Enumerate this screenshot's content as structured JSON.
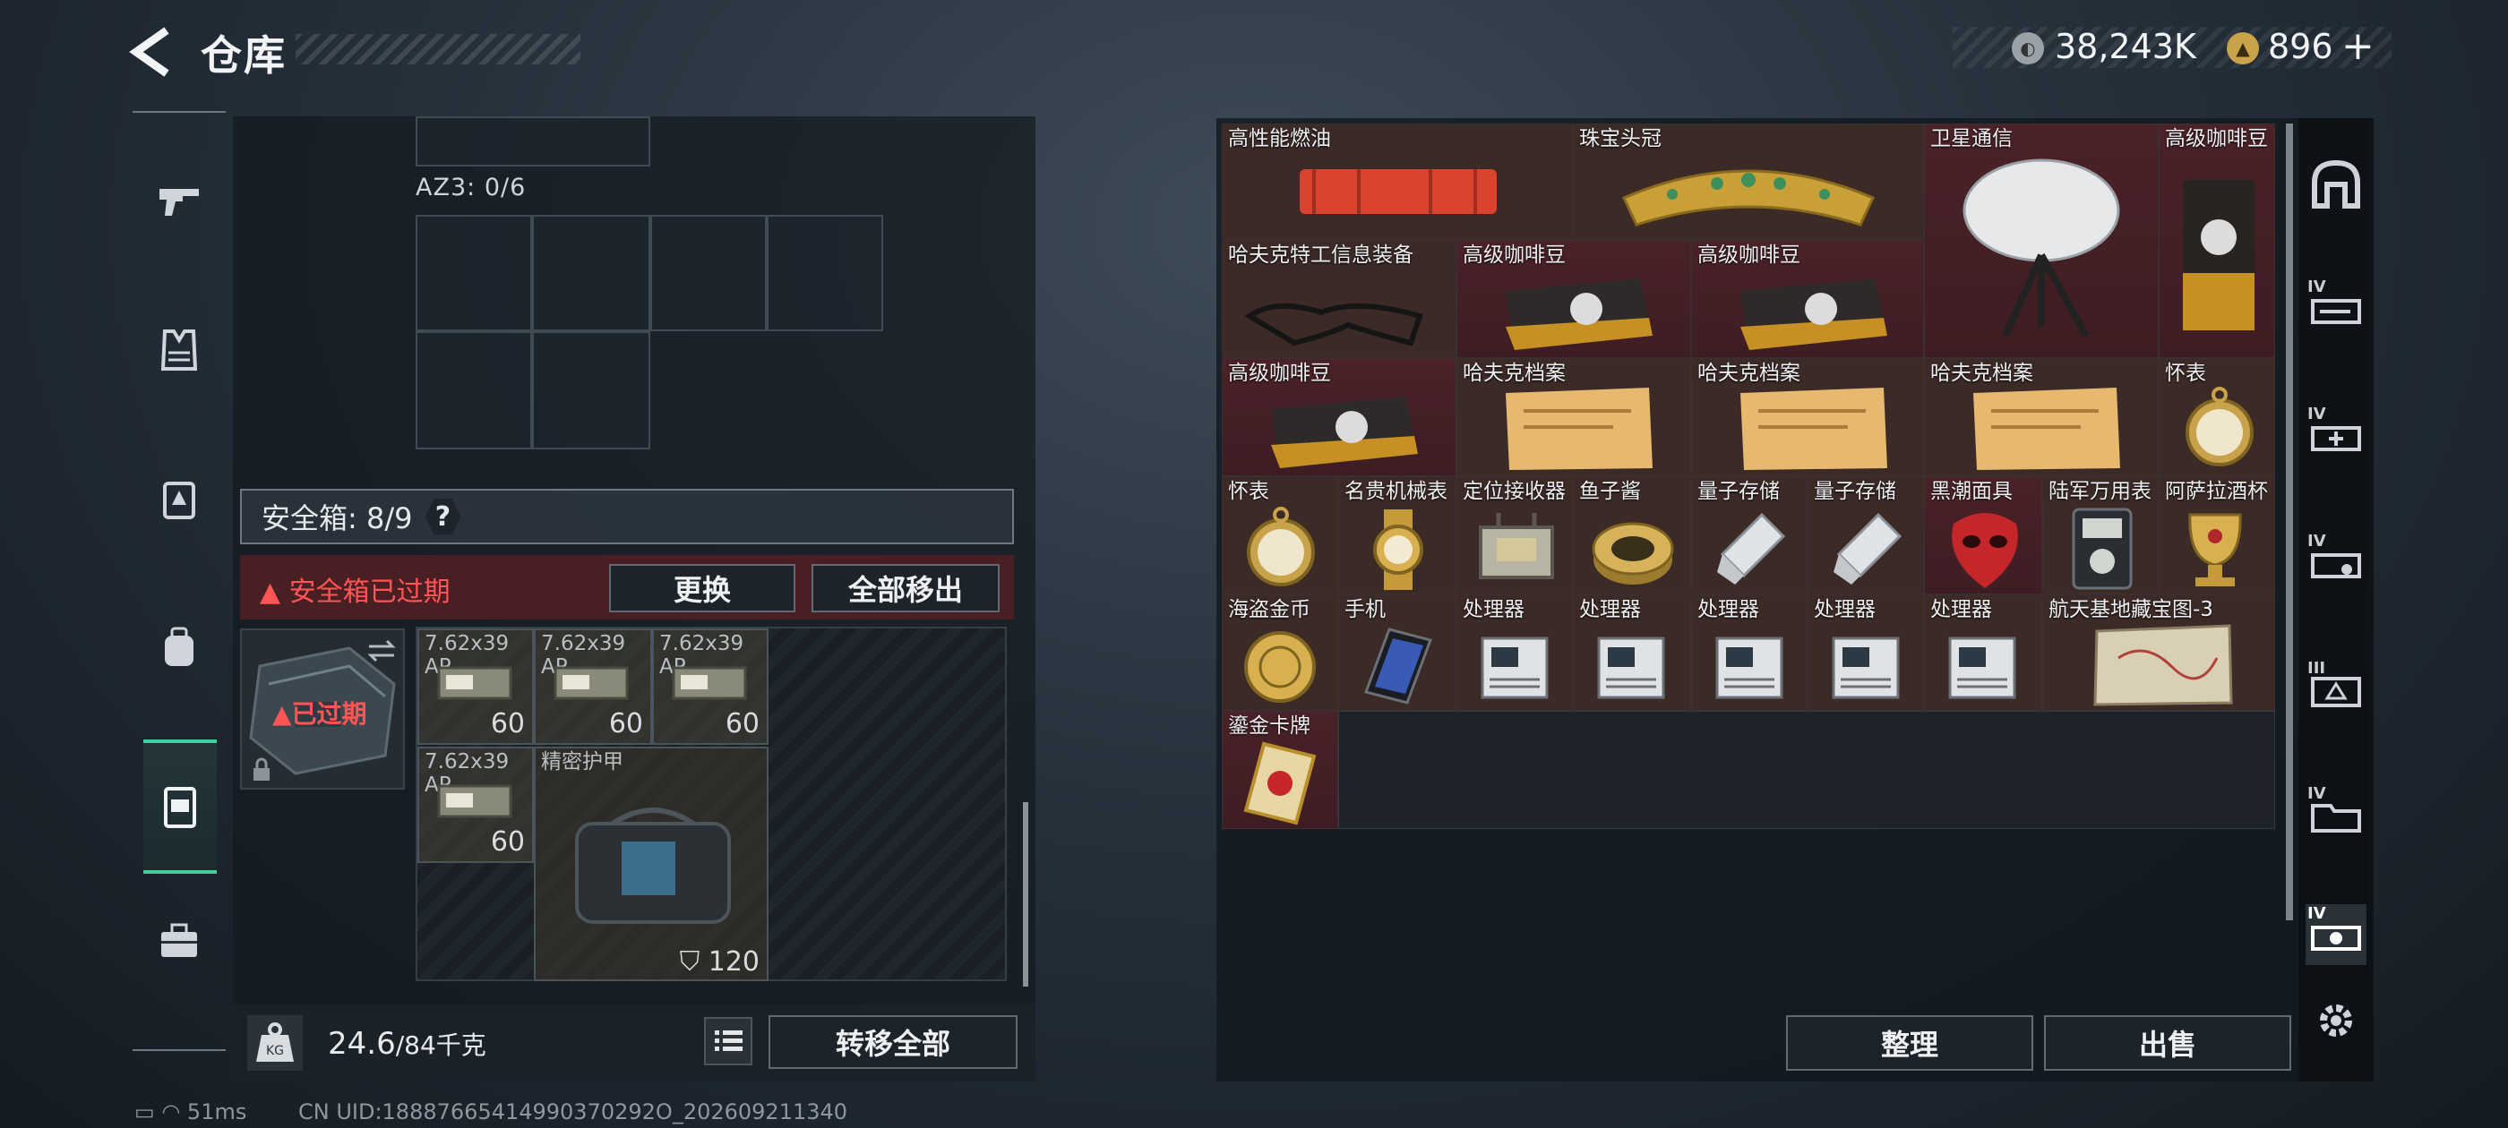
{
  "header": {
    "title": "仓库",
    "currency_silver": "38,243K",
    "currency_gold": "896",
    "plus": "+"
  },
  "left_rail": {
    "items": [
      "weapon-icon",
      "armor-vest-icon",
      "chest-rig-icon",
      "backpack-icon",
      "safe-box-icon",
      "briefcase-icon"
    ],
    "active": "safe-box-icon"
  },
  "az3": {
    "label": "AZ3: 0/6"
  },
  "safebox": {
    "label": "安全箱: 8/9",
    "help": "?",
    "expired_warning": "安全箱已过期",
    "expired_badge": "已过期",
    "replace_btn": "更换",
    "move_all_out_btn": "全部移出"
  },
  "case_items": [
    {
      "name": "7.62x39 AP",
      "count": "60"
    },
    {
      "name": "7.62x39 AP",
      "count": "60"
    },
    {
      "name": "7.62x39 AP",
      "count": "60"
    },
    {
      "name": "7.62x39 AP",
      "count": "60"
    },
    {
      "name": "精密护甲",
      "count": "120"
    }
  ],
  "bottom": {
    "weight": "24.6",
    "weight_max": "/84千克",
    "weight_icon_text": "KG",
    "transfer_all": "转移全部"
  },
  "stash_items": [
    "高性能燃油",
    "珠宝头冠",
    "卫星通信",
    "高级咖啡豆",
    "哈夫克特工信息装备",
    "高级咖啡豆",
    "高级咖啡豆",
    "高级咖啡豆",
    "哈夫克档案",
    "哈夫克档案",
    "哈夫克档案",
    "怀表",
    "怀表",
    "名贵机械表",
    "定位接收器",
    "鱼子酱",
    "量子存储",
    "量子存储",
    "黑潮面具",
    "陆军万用表",
    "阿萨拉酒杯",
    "海盗金币",
    "手机",
    "处理器",
    "处理器",
    "处理器",
    "处理器",
    "处理器",
    "航天基地藏宝图-3",
    "鎏金卡牌"
  ],
  "right_rail": {
    "tiers": [
      "IV",
      "IV",
      "IV",
      "III",
      "IV",
      "IV"
    ]
  },
  "actions": {
    "sort": "整理",
    "sell": "出售"
  },
  "status": {
    "ping": "51ms",
    "uid": "CN UID:18887665414990370292O_2026092113​40"
  }
}
